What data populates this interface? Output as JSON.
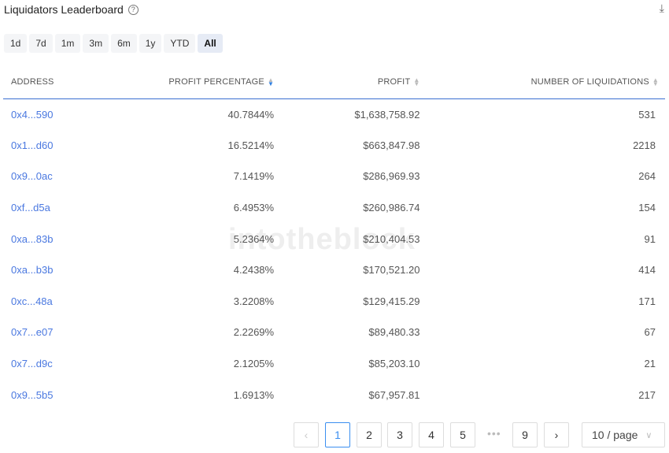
{
  "title": "Liquidators Leaderboard",
  "ranges": [
    "1d",
    "7d",
    "1m",
    "3m",
    "6m",
    "1y",
    "YTD",
    "All"
  ],
  "active_range": "All",
  "columns": [
    "ADDRESS",
    "PROFIT PERCENTAGE",
    "PROFIT",
    "NUMBER OF LIQUIDATIONS"
  ],
  "rows": [
    [
      "0x4...590",
      "40.7844%",
      "$1,638,758.92",
      "531"
    ],
    [
      "0x1...d60",
      "16.5214%",
      "$663,847.98",
      "2218"
    ],
    [
      "0x9...0ac",
      "7.1419%",
      "$286,969.93",
      "264"
    ],
    [
      "0xf...d5a",
      "6.4953%",
      "$260,986.74",
      "154"
    ],
    [
      "0xa...83b",
      "5.2364%",
      "$210,404.53",
      "91"
    ],
    [
      "0xa...b3b",
      "4.2438%",
      "$170,521.20",
      "414"
    ],
    [
      "0xc...48a",
      "3.2208%",
      "$129,415.29",
      "171"
    ],
    [
      "0x7...e07",
      "2.2269%",
      "$89,480.33",
      "67"
    ],
    [
      "0x7...d9c",
      "2.1205%",
      "$85,203.10",
      "21"
    ],
    [
      "0x9...5b5",
      "1.6913%",
      "$67,957.81",
      "217"
    ]
  ],
  "watermark": "intotheblock",
  "pagination": {
    "pages": [
      "1",
      "2",
      "3",
      "4",
      "5",
      "9"
    ],
    "current": "1",
    "ellipsis": "•••",
    "page_size": "10 / page"
  }
}
